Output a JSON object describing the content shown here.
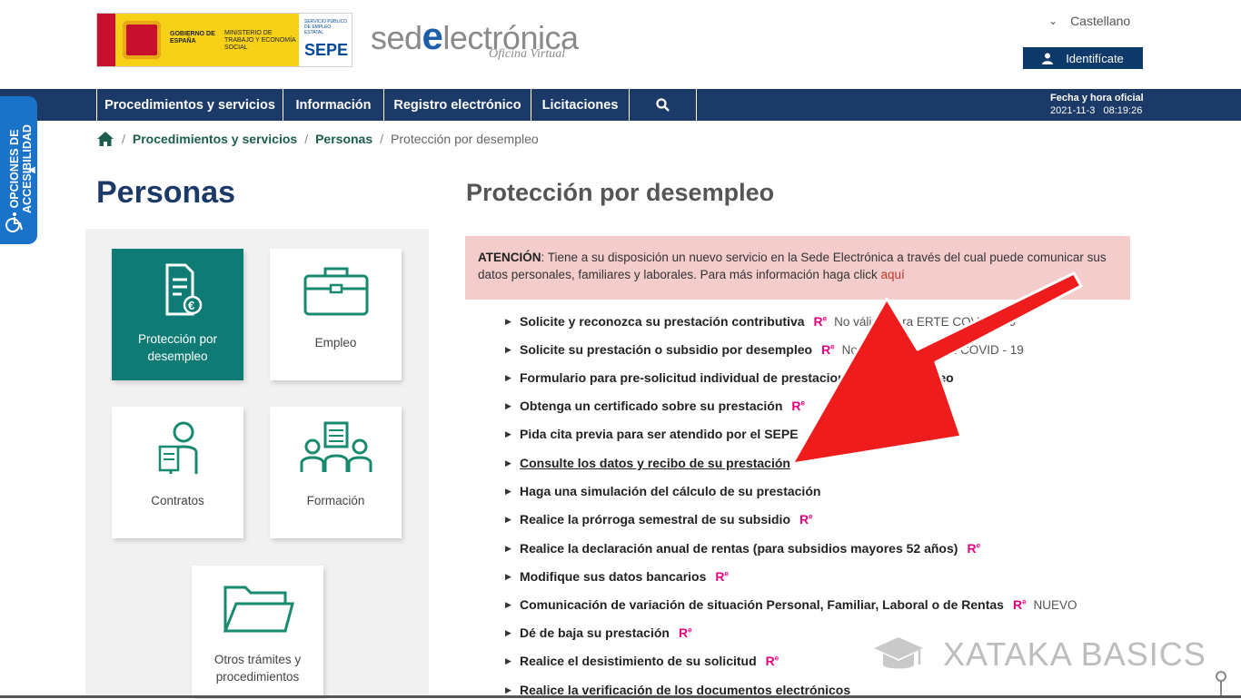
{
  "header": {
    "logo_gob_line1": "GOBIERNO DE ESPAÑA",
    "logo_gob_line2": "MINISTERIO DE TRABAJO Y ECONOMÍA SOCIAL",
    "logo_sepe_small": "SERVICIO PÚBLICO DE EMPLEO ESTATAL",
    "logo_sepe_big": "SEPE",
    "sede_prefix": "sed",
    "sede_e": "e",
    "sede_suffix": "lectrónica",
    "oficina": "Oficina Virtual",
    "language": "Castellano",
    "identify_button": "Identifícate"
  },
  "nav": {
    "items": [
      "Procedimientos y servicios",
      "Información",
      "Registro electrónico",
      "Licitaciones"
    ],
    "search_icon": "search-icon",
    "date_label": "Fecha y hora oficial",
    "date_value": "2021-11-3",
    "time_value": "08:19:26"
  },
  "accessibility": {
    "label": "OPCIONES DE ACCESIBILIDAD"
  },
  "breadcrumb": {
    "home_icon": "home-icon",
    "items": [
      "Procedimientos y servicios",
      "Personas",
      "Protección por desempleo"
    ]
  },
  "left": {
    "title": "Personas",
    "tiles": [
      {
        "label_1": "Protección por",
        "label_2": "desempleo",
        "icon": "document-euro-icon",
        "active": true
      },
      {
        "label_1": "Empleo",
        "label_2": "",
        "icon": "briefcase-icon"
      },
      {
        "label_1": "Contratos",
        "label_2": "",
        "icon": "contract-person-icon"
      },
      {
        "label_1": "Formación",
        "label_2": "",
        "icon": "training-icon"
      },
      {
        "label_1": "Otros trámites y",
        "label_2": "procedimientos",
        "icon": "folder-icon"
      }
    ]
  },
  "main": {
    "title": "Protección por desempleo",
    "notice": {
      "strong": "ATENCIÓN",
      "text": ": Tiene a su disposición un nuevo servicio en la Sede Electrónica a través del cual puede comunicar sus datos personales, familiares y laborales. Para más información haga click ",
      "link": "aquí"
    },
    "re_label": "R",
    "re_sup": "e",
    "links": [
      {
        "text": "Solicite y reconozca su prestación contributiva",
        "re": true,
        "note": "No válido para ERTE COVID - 19"
      },
      {
        "text": "Solicite su prestación o subsidio por desempleo",
        "re": true,
        "note": "No válido para ERTE COVID - 19"
      },
      {
        "text": "Formulario para pre-solicitud individual de prestaciones por desempleo",
        "re": false,
        "note": ""
      },
      {
        "text": "Obtenga un certificado sobre su prestación",
        "re": true,
        "note": ""
      },
      {
        "text": "Pida cita previa para ser atendido por el SEPE",
        "re": false,
        "note": ""
      },
      {
        "text": "Consulte los datos y recibo de su prestación",
        "re": false,
        "note": "",
        "underline": true
      },
      {
        "text": "Haga una simulación del cálculo de su prestación",
        "re": false,
        "note": ""
      },
      {
        "text": "Realice la prórroga semestral de su subsidio",
        "re": true,
        "note": ""
      },
      {
        "text": "Realice la declaración anual de rentas (para subsidios mayores 52 años)",
        "re": true,
        "note": ""
      },
      {
        "text": "Modifique sus datos bancarios",
        "re": true,
        "note": ""
      },
      {
        "text": "Comunicación de variación de situación Personal, Familiar, Laboral o de Rentas",
        "re": true,
        "note": "NUEVO"
      },
      {
        "text": "Dé de baja su prestación",
        "re": true,
        "note": ""
      },
      {
        "text": "Realice el desistimiento de su solicitud",
        "re": true,
        "note": ""
      },
      {
        "text": "Realice la verificación de los documentos electrónicos",
        "re": false,
        "note": ""
      }
    ]
  },
  "watermark": {
    "text": "XATAKA BASICS"
  },
  "colors": {
    "nav": "#1b3a68",
    "teal": "#0e7c75",
    "notice_bg": "#f4cccc",
    "re": "#e6007e",
    "arrow": "#ee1c1c"
  }
}
